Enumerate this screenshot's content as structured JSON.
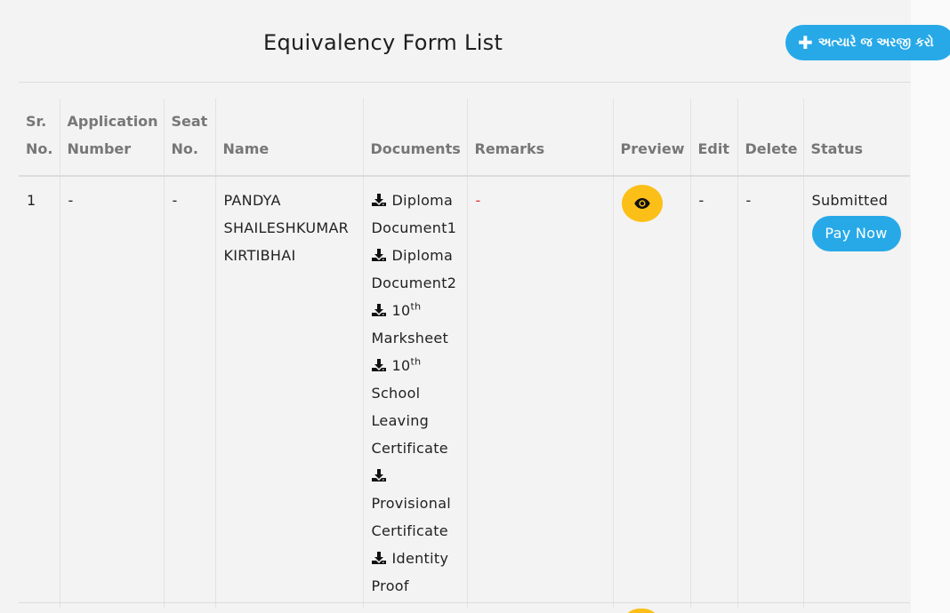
{
  "page": {
    "title": "Equivalency Form List",
    "apply_button": "અત્યારે જ અરજી કરો"
  },
  "table": {
    "headers": {
      "sr_no": [
        "Sr.",
        "No."
      ],
      "application_number": [
        "Application",
        "Number"
      ],
      "seat_no": [
        "Seat",
        "No."
      ],
      "name": "Name",
      "documents": "Documents",
      "remarks": "Remarks",
      "preview": "Preview",
      "edit": "Edit",
      "delete": "Delete",
      "status": "Status"
    },
    "rows": [
      {
        "sr_no": "1",
        "application_number": "-",
        "seat_no": "-",
        "name_lines": [
          "PANDYA",
          "SHAILESHKUMAR",
          "KIRTIBHAI"
        ],
        "documents": [
          {
            "lines": [
              "Diploma",
              "Document1"
            ]
          },
          {
            "lines": [
              "Diploma",
              "Document2"
            ]
          },
          {
            "prefix": "10",
            "sup": "th",
            "lines": [
              "Marksheet"
            ]
          },
          {
            "prefix": "10",
            "sup": "th",
            "lines": [
              "School",
              "Leaving",
              "Certificate"
            ]
          },
          {
            "lines": [
              "",
              "Provisional",
              "Certificate"
            ]
          },
          {
            "lines": [
              "Identity",
              "Proof"
            ]
          }
        ],
        "remarks": "-",
        "edit": "-",
        "delete": "-",
        "status": "Submitted",
        "pay_button": "Pay Now"
      }
    ]
  },
  "colors": {
    "primary_button": "#27a9e8",
    "preview_button": "#fbbf17",
    "remarks_dash": "#d9302c"
  },
  "icons": {
    "download": "download-icon",
    "preview": "eye-icon",
    "add": "plus-icon"
  }
}
